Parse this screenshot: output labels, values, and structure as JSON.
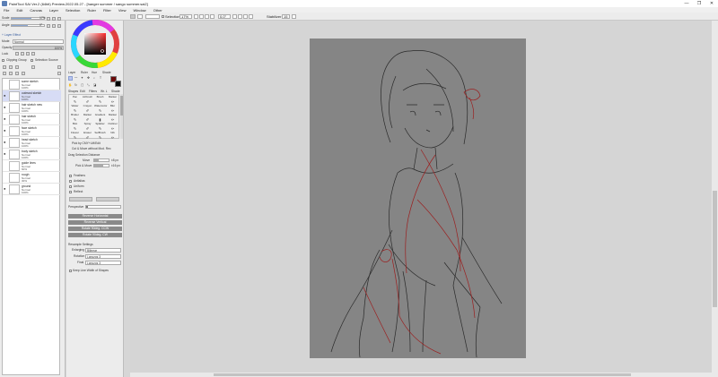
{
  "window": {
    "title": "PaintTool SAI Ver.2 (64bit) Preview.2022.05.27 - [hanger summer / sango summer.sai2]",
    "minimize_glyph": "—",
    "maximize_glyph": "❐",
    "close_glyph": "✕"
  },
  "menu": [
    "File",
    "Edit",
    "Canvas",
    "Layer",
    "Selection",
    "Ruler",
    "Filter",
    "View",
    "Window",
    "Other"
  ],
  "toolbar": {
    "selection_label": "Selection",
    "zoom_value": "17%",
    "angle_value": "0.0°",
    "stabilizer_label": "Stabilizer",
    "stabilizer_value": "15"
  },
  "layer_properties": {
    "rows": [
      {
        "label": "Scale",
        "value": "17%"
      },
      {
        "label": "Angle",
        "value": "0°"
      }
    ],
    "layer_effect_label": "+ Layer Effect",
    "mode_label": "Mode",
    "mode_value": "Normal",
    "opacity_label": "Opacity",
    "opacity_value": "100%",
    "lock_label": "Lock",
    "clipping_group_label": "Clipping Group",
    "selection_source_label": "Selection Source"
  },
  "layers": [
    {
      "name": "some sketch",
      "mode": "Normal",
      "opacity": "100%",
      "selected": false,
      "visible": false
    },
    {
      "name": "outmost sketch",
      "mode": "Normal",
      "opacity": "100%",
      "selected": true,
      "visible": true
    },
    {
      "name": "hair sketch new",
      "mode": "Normal",
      "opacity": "100%",
      "selected": false,
      "visible": true
    },
    {
      "name": "hair sketch",
      "mode": "Normal",
      "opacity": "100%",
      "selected": false,
      "visible": true
    },
    {
      "name": "face sketch",
      "mode": "Normal",
      "opacity": "100%",
      "selected": false,
      "visible": true
    },
    {
      "name": "head sketch",
      "mode": "Normal",
      "opacity": "100%",
      "selected": false,
      "visible": true
    },
    {
      "name": "body sketch",
      "mode": "Normal",
      "opacity": "100%",
      "selected": false,
      "visible": true
    },
    {
      "name": "guide lines",
      "mode": "Normal",
      "opacity": "60%",
      "selected": false,
      "visible": false
    },
    {
      "name": "rough",
      "mode": "Normal",
      "opacity": "30%",
      "selected": false,
      "visible": false
    },
    {
      "name": "ground",
      "mode": "Normal",
      "opacity": "100%",
      "selected": false,
      "visible": true
    }
  ],
  "color": {
    "primary": "#6b0a0a",
    "secondary": "#000000",
    "tabs": [
      "Layer",
      "Ruler",
      "Hue",
      "Shade"
    ]
  },
  "tools": {
    "tabs": [
      "Shapes",
      "Edit",
      "Filters",
      "Wr. L",
      "Shade"
    ],
    "grid": [
      {
        "name": "Pen",
        "icon": "pen-icon"
      },
      {
        "name": "Airbrush",
        "icon": "airbrush-icon"
      },
      {
        "name": "Brush",
        "icon": "brush-icon"
      },
      {
        "name": "Marker",
        "icon": "marker-icon"
      },
      {
        "name": "Water",
        "icon": "water-icon"
      },
      {
        "name": "Crayon",
        "icon": "crayon-icon"
      },
      {
        "name": "Watercolor",
        "icon": "watercolor-icon"
      },
      {
        "name": "Blur",
        "icon": "blur-icon"
      },
      {
        "name": "Binder",
        "icon": "binder-icon"
      },
      {
        "name": "Marker",
        "icon": "marker2-icon"
      },
      {
        "name": "Gradient",
        "icon": "gradient-icon"
      },
      {
        "name": "Marker",
        "icon": "marker3-icon"
      },
      {
        "name": "Blot",
        "icon": "blot-icon"
      },
      {
        "name": "Spray",
        "icon": "spray-icon"
      },
      {
        "name": "Splatter",
        "icon": "splatter-icon"
      },
      {
        "name": "Outliner",
        "icon": "outliner-icon"
      },
      {
        "name": "Flower",
        "icon": "flower-icon"
      },
      {
        "name": "Eraser",
        "icon": "eraser-icon"
      },
      {
        "name": "SelBrush",
        "icon": "selbrush-icon"
      },
      {
        "name": "Nib",
        "icon": "nib-icon"
      }
    ],
    "pick_cmy_label": "Pick by CMY+Lift/Edit",
    "cut_move_label": "Cut & Move without Mod. Rec",
    "drag_section_label": "Drag Selection Distance",
    "move_label": "Move",
    "move_value": "±8 px",
    "pick_move_label": "Pick & Move",
    "pick_move_value": "±16 px",
    "checkbox_labels": [
      "Feathers",
      "Antialias",
      "Uniform",
      "Reflect"
    ],
    "perspective_label": "Perspective",
    "reverse_horizontal": "Reverse Horizontal",
    "reverse_vertical": "Reverse Vertical",
    "rotate_90_ccw": "Rotate 90deg. CCW",
    "rotate_90_cw": "Rotate 90deg. CW",
    "resample_label": "Resample Settings",
    "enlarging_label": "Enlarging",
    "enlarging_value": "Bilinear",
    "rotation_label": "Rotation",
    "rotation_value": "Lanczos 3",
    "final_label": "Final",
    "final_value": "Lanczos 3",
    "keep_line_width_label": "Keep Line Width of Shapes"
  }
}
